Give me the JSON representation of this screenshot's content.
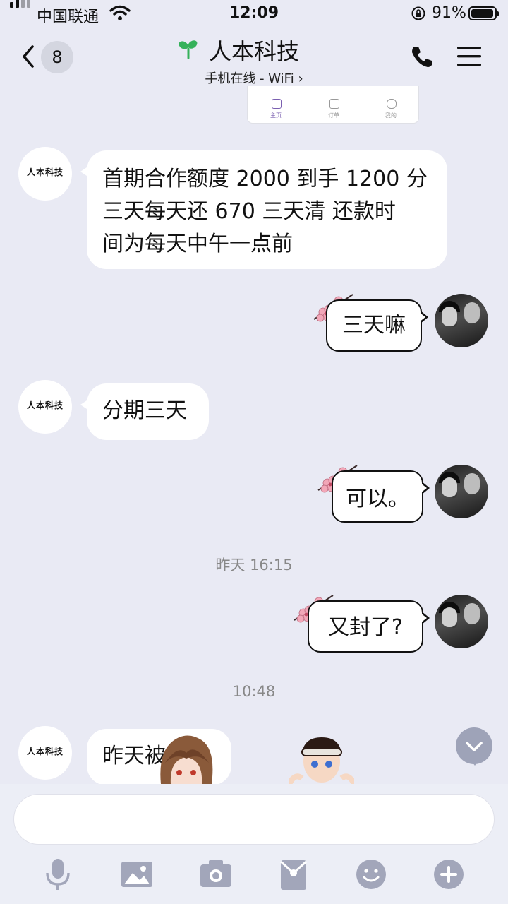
{
  "status_bar": {
    "carrier": "中国联通",
    "time": "12:09",
    "battery_percent": "91%",
    "battery_level": 0.91
  },
  "header": {
    "back_badge": "8",
    "title": "人本科技",
    "subtitle": "手机在线 - WiFi",
    "icons": [
      "back-chevron-icon",
      "sprout-icon",
      "phone-icon",
      "menu-icon"
    ]
  },
  "embedded_screenshot": {
    "tabs": [
      "主页",
      "订单",
      "我的"
    ]
  },
  "contact_avatar_text": "人本科技",
  "messages": [
    {
      "side": "in",
      "lines": [
        "首期合作额度 2000 到手 1200 分",
        "三天每天还 670 三天清  还款时",
        "间为每天中午一点前"
      ]
    },
    {
      "side": "out",
      "text": "三天嘛"
    },
    {
      "side": "in",
      "text": "分期三天"
    },
    {
      "side": "out",
      "text": "可以。"
    },
    {
      "side": "out",
      "text": "又封了?"
    },
    {
      "side": "in",
      "text": "昨天被封了"
    }
  ],
  "timestamps": [
    "昨天 16:15",
    "10:48"
  ],
  "toolbar": {
    "icons": [
      "microphone-icon",
      "image-icon",
      "camera-icon",
      "red-packet-icon",
      "emoji-icon",
      "add-icon"
    ]
  },
  "colors": {
    "background": "#e9eaf4",
    "bubble": "#ffffff",
    "accent_green": "#35b15a",
    "toolbar_icon": "#a2a6ba"
  }
}
